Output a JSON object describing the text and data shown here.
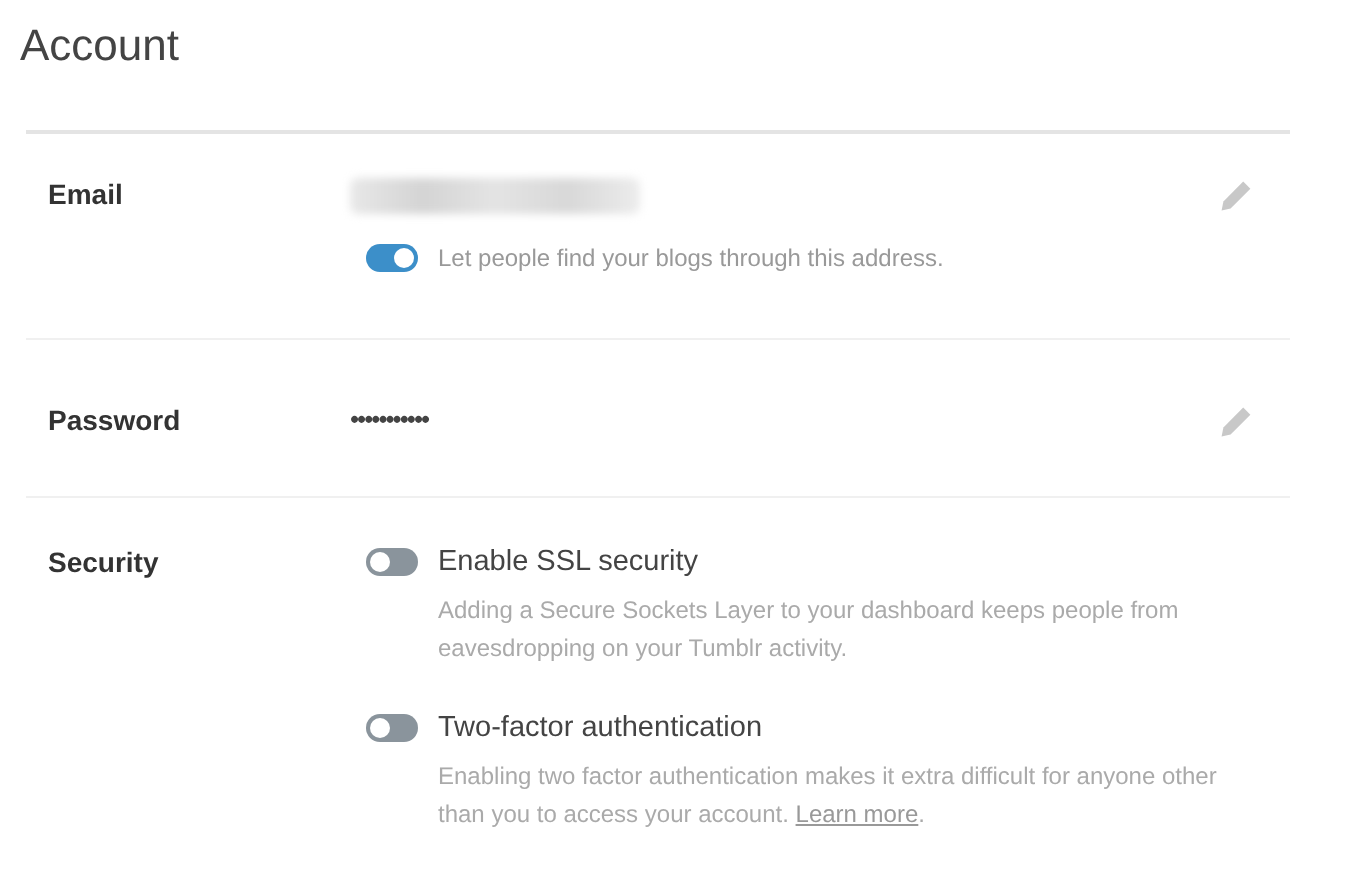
{
  "title": "Account",
  "rows": [
    {
      "label": "Email",
      "kind": "email",
      "editable": true,
      "toggles": [
        {
          "on": true,
          "label": "Let people find your blogs through this address.",
          "kind": "inline"
        }
      ]
    },
    {
      "label": "Password",
      "kind": "password",
      "value": "•••••••••••",
      "editable": true
    },
    {
      "label": "Security",
      "kind": "toggles",
      "toggles": [
        {
          "on": false,
          "label": "Enable SSL security",
          "kind": "titled",
          "description": "Adding a Secure Sockets Layer to your dashboard keeps people from eavesdropping on your Tumblr activity."
        },
        {
          "on": false,
          "label": "Two-factor authentication",
          "kind": "titled",
          "description": "Enabling two factor authentication makes it extra difficult for anyone other than you to access your account.",
          "link": "Learn more",
          "after_link": "."
        }
      ]
    }
  ]
}
